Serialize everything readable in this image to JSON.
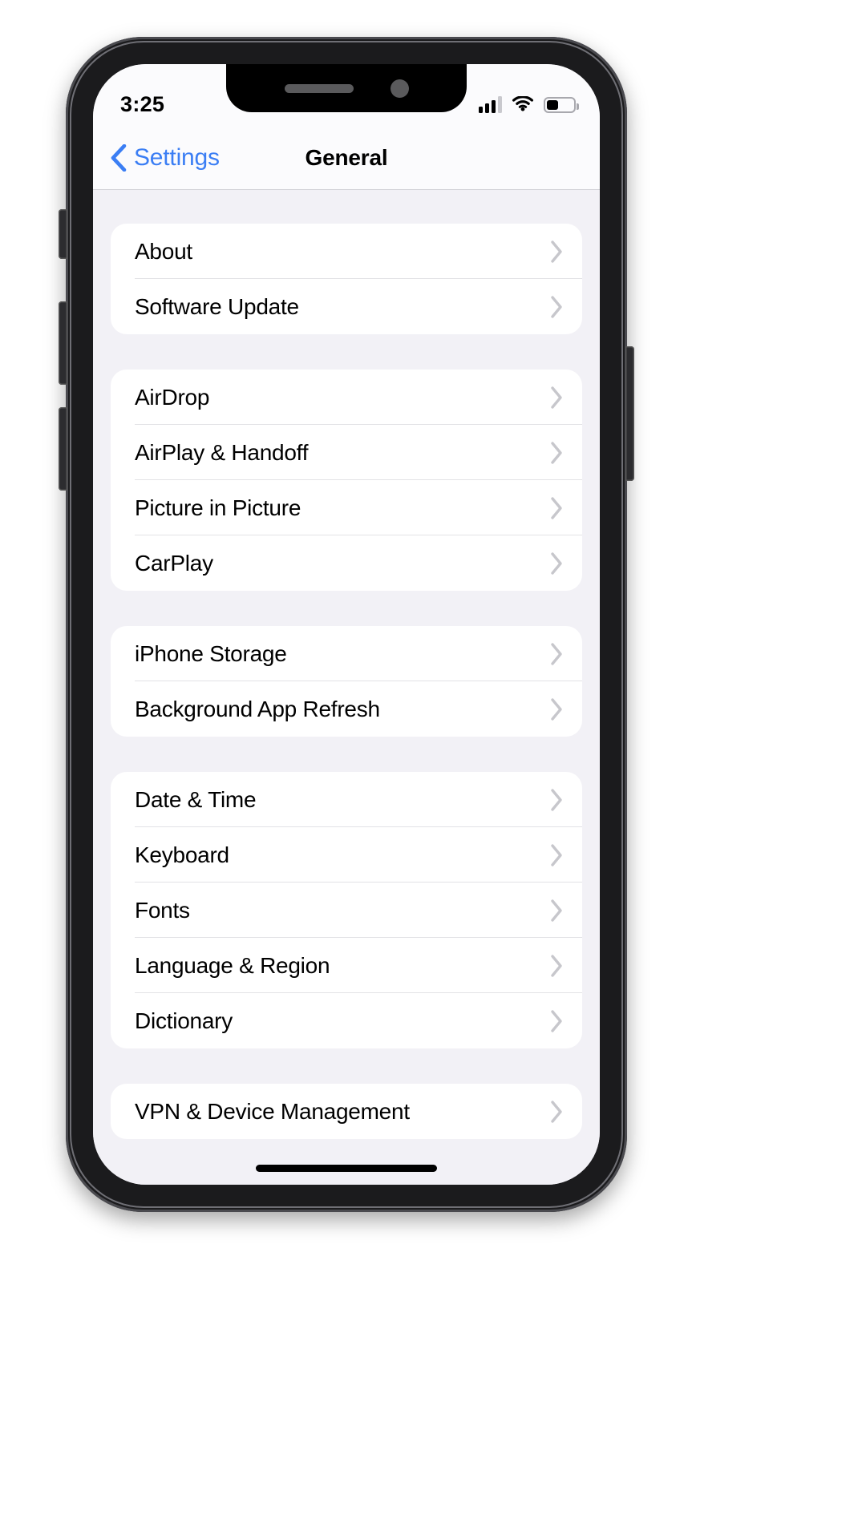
{
  "device": {
    "notch": {
      "speaker": "speaker-slot",
      "camera": "front-camera"
    }
  },
  "status_bar": {
    "time": "3:25",
    "signal_icon": "cellular-signal-icon",
    "signal_bars_total": 4,
    "signal_bars_filled": 3,
    "wifi_icon": "wifi-icon",
    "battery_icon": "battery-icon",
    "battery_percent": 45
  },
  "nav_bar": {
    "back_icon": "chevron-left-icon",
    "back_label": "Settings",
    "title": "General",
    "tint_color": "#3b7ef4"
  },
  "colors": {
    "background": "#f2f1f6",
    "card": "#ffffff",
    "separator": "#e2e2e6",
    "chevron": "#c7c7cc",
    "text": "#000000"
  },
  "groups": [
    {
      "rows": [
        {
          "label": "About"
        },
        {
          "label": "Software Update"
        }
      ]
    },
    {
      "rows": [
        {
          "label": "AirDrop"
        },
        {
          "label": "AirPlay & Handoff"
        },
        {
          "label": "Picture in Picture"
        },
        {
          "label": "CarPlay"
        }
      ]
    },
    {
      "rows": [
        {
          "label": "iPhone Storage"
        },
        {
          "label": "Background App Refresh"
        }
      ]
    },
    {
      "rows": [
        {
          "label": "Date & Time"
        },
        {
          "label": "Keyboard"
        },
        {
          "label": "Fonts"
        },
        {
          "label": "Language & Region"
        },
        {
          "label": "Dictionary"
        }
      ]
    },
    {
      "rows": [
        {
          "label": "VPN & Device Management"
        }
      ]
    }
  ]
}
